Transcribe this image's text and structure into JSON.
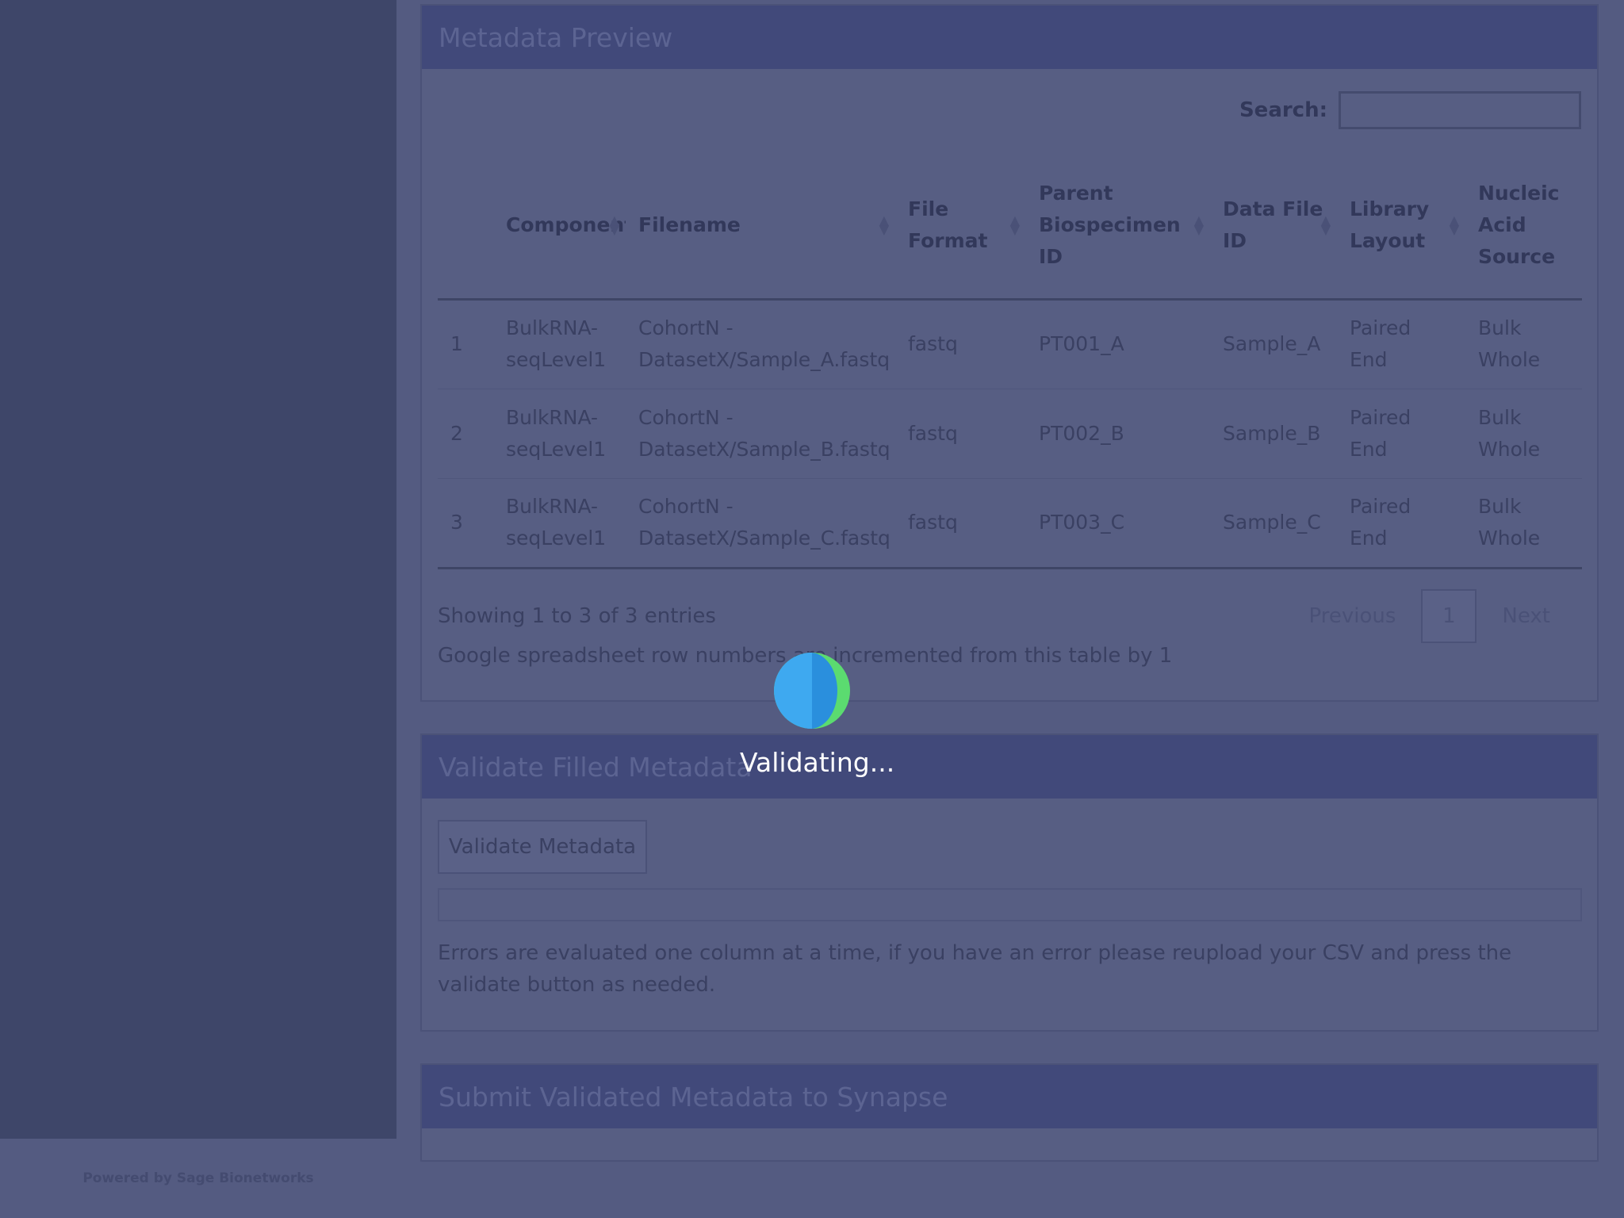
{
  "sidebar": {
    "footer": "Powered by Sage Bionetworks"
  },
  "preview": {
    "title": "Metadata Preview",
    "search_label": "Search:",
    "columns": [
      "",
      "Component",
      "Filename",
      "File Format",
      "Parent Biospecimen ID",
      "Data File ID",
      "Library Layout",
      "Nucleic Acid Source"
    ],
    "rows": [
      [
        "1",
        "BulkRNA-seqLevel1",
        "CohortN - DatasetX/Sample_A.fastq",
        "fastq",
        "PT001_A",
        "Sample_A",
        "Paired End",
        "Bulk Whole"
      ],
      [
        "2",
        "BulkRNA-seqLevel1",
        "CohortN - DatasetX/Sample_B.fastq",
        "fastq",
        "PT002_B",
        "Sample_B",
        "Paired End",
        "Bulk Whole"
      ],
      [
        "3",
        "BulkRNA-seqLevel1",
        "CohortN - DatasetX/Sample_C.fastq",
        "fastq",
        "PT003_C",
        "Sample_C",
        "Paired End",
        "Bulk Whole"
      ]
    ],
    "info": "Showing 1 to 3 of 3 entries",
    "prev": "Previous",
    "page": "1",
    "next": "Next",
    "note": "Google spreadsheet row numbers are incremented from this table by 1"
  },
  "validate": {
    "title": "Validate Filled Metadata",
    "button": "Validate Metadata",
    "note": "Errors are evaluated one column at a time, if you have an error please reupload your CSV and press the validate button as needed."
  },
  "submit": {
    "title": "Submit Validated Metadata to Synapse"
  },
  "loading": {
    "text": "Validating...",
    "colors": {
      "blue": "#3ea9f0",
      "dark_blue": "#2a8fdd",
      "green": "#5bdb70"
    }
  }
}
